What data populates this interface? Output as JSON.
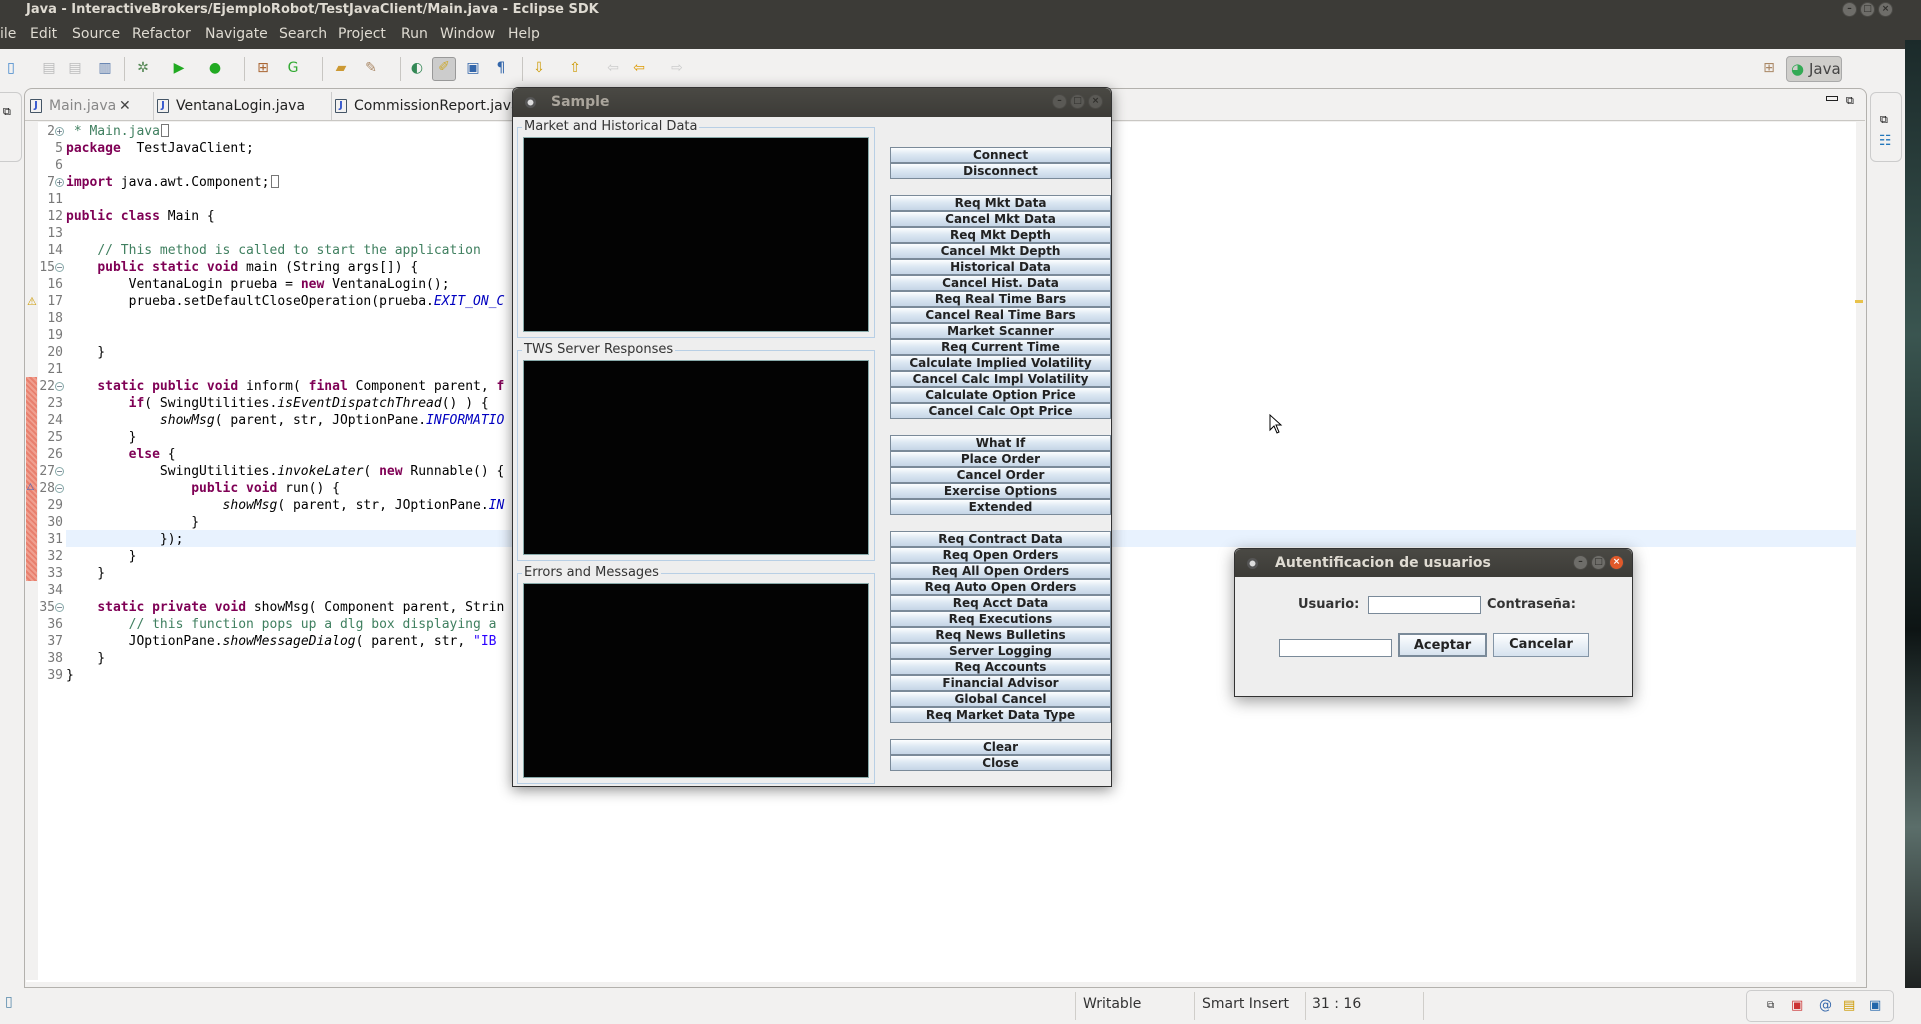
{
  "window": {
    "title": "Java - InteractiveBrokers/EjemploRobot/TestJavaClient/Main.java - Eclipse SDK"
  },
  "menu": [
    "ile",
    "Edit",
    "Source",
    "Refactor",
    "Navigate",
    "Search",
    "Project",
    "Run",
    "Window",
    "Help"
  ],
  "perspective": {
    "label": "Java"
  },
  "tabs": [
    {
      "label": "Main.java",
      "active": true
    },
    {
      "label": "VentanaLogin.java"
    },
    {
      "label": "CommissionReport.java"
    }
  ],
  "code": [
    {
      "n": "2",
      "fold": "+",
      "t": [
        [
          "cm",
          " * Main.java"
        ],
        [
          "box",
          ""
        ]
      ]
    },
    {
      "n": "5",
      "t": [
        [
          "kw",
          "package"
        ],
        [
          "",
          "  TestJavaClient;"
        ]
      ]
    },
    {
      "n": "6",
      "t": []
    },
    {
      "n": "7",
      "fold": "+",
      "t": [
        [
          "kw",
          "import"
        ],
        [
          "",
          " java.awt.Component;"
        ],
        [
          "box",
          ""
        ]
      ]
    },
    {
      "n": "11",
      "t": []
    },
    {
      "n": "12",
      "t": [
        [
          "kw",
          "public class"
        ],
        [
          "",
          " Main {"
        ]
      ]
    },
    {
      "n": "13",
      "t": []
    },
    {
      "n": "14",
      "t": [
        [
          "",
          "    "
        ],
        [
          "cm",
          "// This method is called to start the application"
        ]
      ]
    },
    {
      "n": "15",
      "fold": "-",
      "t": [
        [
          "",
          "    "
        ],
        [
          "kw",
          "public static void"
        ],
        [
          "",
          " main (String args[]) {"
        ]
      ]
    },
    {
      "n": "16",
      "t": [
        [
          "",
          "        VentanaLogin prueba = "
        ],
        [
          "kw",
          "new"
        ],
        [
          "",
          " VentanaLogin();"
        ]
      ]
    },
    {
      "n": "17",
      "t": [
        [
          "",
          "        prueba.setDefaultCloseOperation(prueba."
        ],
        [
          "cf",
          "EXIT_ON_C"
        ]
      ]
    },
    {
      "n": "18",
      "t": []
    },
    {
      "n": "19",
      "t": []
    },
    {
      "n": "20",
      "t": [
        [
          "",
          "    }"
        ]
      ]
    },
    {
      "n": "21",
      "t": []
    },
    {
      "n": "22",
      "fold": "-",
      "t": [
        [
          "",
          "    "
        ],
        [
          "kw",
          "static public void"
        ],
        [
          "",
          " inform( "
        ],
        [
          "kw",
          "final"
        ],
        [
          "",
          " Component parent, "
        ],
        [
          "kw",
          "f"
        ]
      ]
    },
    {
      "n": "23",
      "t": [
        [
          "",
          "        "
        ],
        [
          "kw",
          "if"
        ],
        [
          "",
          "( SwingUtilities."
        ],
        [
          "it",
          "isEventDispatchThread"
        ],
        [
          "",
          "() ) {"
        ]
      ]
    },
    {
      "n": "24",
      "t": [
        [
          "",
          "            "
        ],
        [
          "it",
          "showMsg"
        ],
        [
          "",
          "( parent, str, JOptionPane."
        ],
        [
          "cf",
          "INFORMATIO"
        ]
      ]
    },
    {
      "n": "25",
      "t": [
        [
          "",
          "        }"
        ]
      ]
    },
    {
      "n": "26",
      "t": [
        [
          "",
          "        "
        ],
        [
          "kw",
          "else"
        ],
        [
          "",
          " {"
        ]
      ]
    },
    {
      "n": "27",
      "fold": "-",
      "t": [
        [
          "",
          "            SwingUtilities."
        ],
        [
          "it",
          "invokeLater"
        ],
        [
          "",
          "( "
        ],
        [
          "kw",
          "new"
        ],
        [
          "",
          " Runnable() {"
        ]
      ]
    },
    {
      "n": "28",
      "fold": "-",
      "t": [
        [
          "",
          "                "
        ],
        [
          "kw",
          "public void"
        ],
        [
          "",
          " run() {"
        ]
      ]
    },
    {
      "n": "29",
      "t": [
        [
          "",
          "                    "
        ],
        [
          "it",
          "showMsg"
        ],
        [
          "",
          "( parent, str, JOptionPane."
        ],
        [
          "cf",
          "IN"
        ]
      ]
    },
    {
      "n": "30",
      "t": [
        [
          "",
          "                }"
        ]
      ]
    },
    {
      "n": "31",
      "t": [
        [
          "",
          "            });"
        ]
      ]
    },
    {
      "n": "32",
      "t": [
        [
          "",
          "        }"
        ]
      ]
    },
    {
      "n": "33",
      "t": [
        [
          "",
          "    }"
        ]
      ]
    },
    {
      "n": "34",
      "t": []
    },
    {
      "n": "35",
      "fold": "-",
      "t": [
        [
          "",
          "    "
        ],
        [
          "kw",
          "static private void"
        ],
        [
          "",
          " showMsg( Component parent, Strin"
        ]
      ]
    },
    {
      "n": "36",
      "t": [
        [
          "",
          "        "
        ],
        [
          "cm",
          "// this function pops up a dlg box displaying a"
        ]
      ]
    },
    {
      "n": "37",
      "t": [
        [
          "",
          "        JOptionPane."
        ],
        [
          "it",
          "showMessageDialog"
        ],
        [
          "",
          "( parent, str, "
        ],
        [
          "sq",
          "\"IB"
        ]
      ]
    },
    {
      "n": "38",
      "t": [
        [
          "",
          "    }"
        ]
      ]
    },
    {
      "n": "39",
      "t": [
        [
          "",
          "}"
        ]
      ]
    }
  ],
  "status": {
    "writable": "Writable",
    "insert_mode": "Smart Insert",
    "position": "31 : 16"
  },
  "sample": {
    "title": "Sample",
    "groups": [
      "Market and Historical Data",
      "TWS Server Responses",
      "Errors and Messages"
    ],
    "button_groups": [
      [
        "Connect",
        "Disconnect"
      ],
      [
        "Req Mkt Data",
        "Cancel Mkt Data",
        "Req Mkt Depth",
        "Cancel Mkt Depth",
        "Historical Data",
        "Cancel Hist. Data",
        "Req Real Time Bars",
        "Cancel Real Time Bars",
        "Market Scanner",
        "Req Current Time",
        "Calculate Implied Volatility",
        "Cancel Calc Impl Volatility",
        "Calculate Option Price",
        "Cancel Calc Opt Price"
      ],
      [
        "What If",
        "Place Order",
        "Cancel Order",
        "Exercise Options",
        "Extended"
      ],
      [
        "Req Contract Data",
        "Req Open Orders",
        "Req All Open Orders",
        "Req Auto Open Orders",
        "Req Acct Data",
        "Req Executions",
        "Req News Bulletins",
        "Server Logging",
        "Req Accounts",
        "Financial Advisor",
        "Global Cancel",
        "Req Market Data Type"
      ],
      [
        "Clear",
        "Close"
      ]
    ]
  },
  "login": {
    "title": "Autentificacion de usuarios",
    "user_label": "Usuario:",
    "user_value": "",
    "password_label": "Contraseña:",
    "password_value": "",
    "accept": "Aceptar",
    "cancel": "Cancelar"
  },
  "colors": {
    "keyword": "#7f0055",
    "comment": "#3f7f5f",
    "constant": "#0000c0",
    "titlebar": "#3c3b37",
    "close_button": "#e0592a"
  }
}
